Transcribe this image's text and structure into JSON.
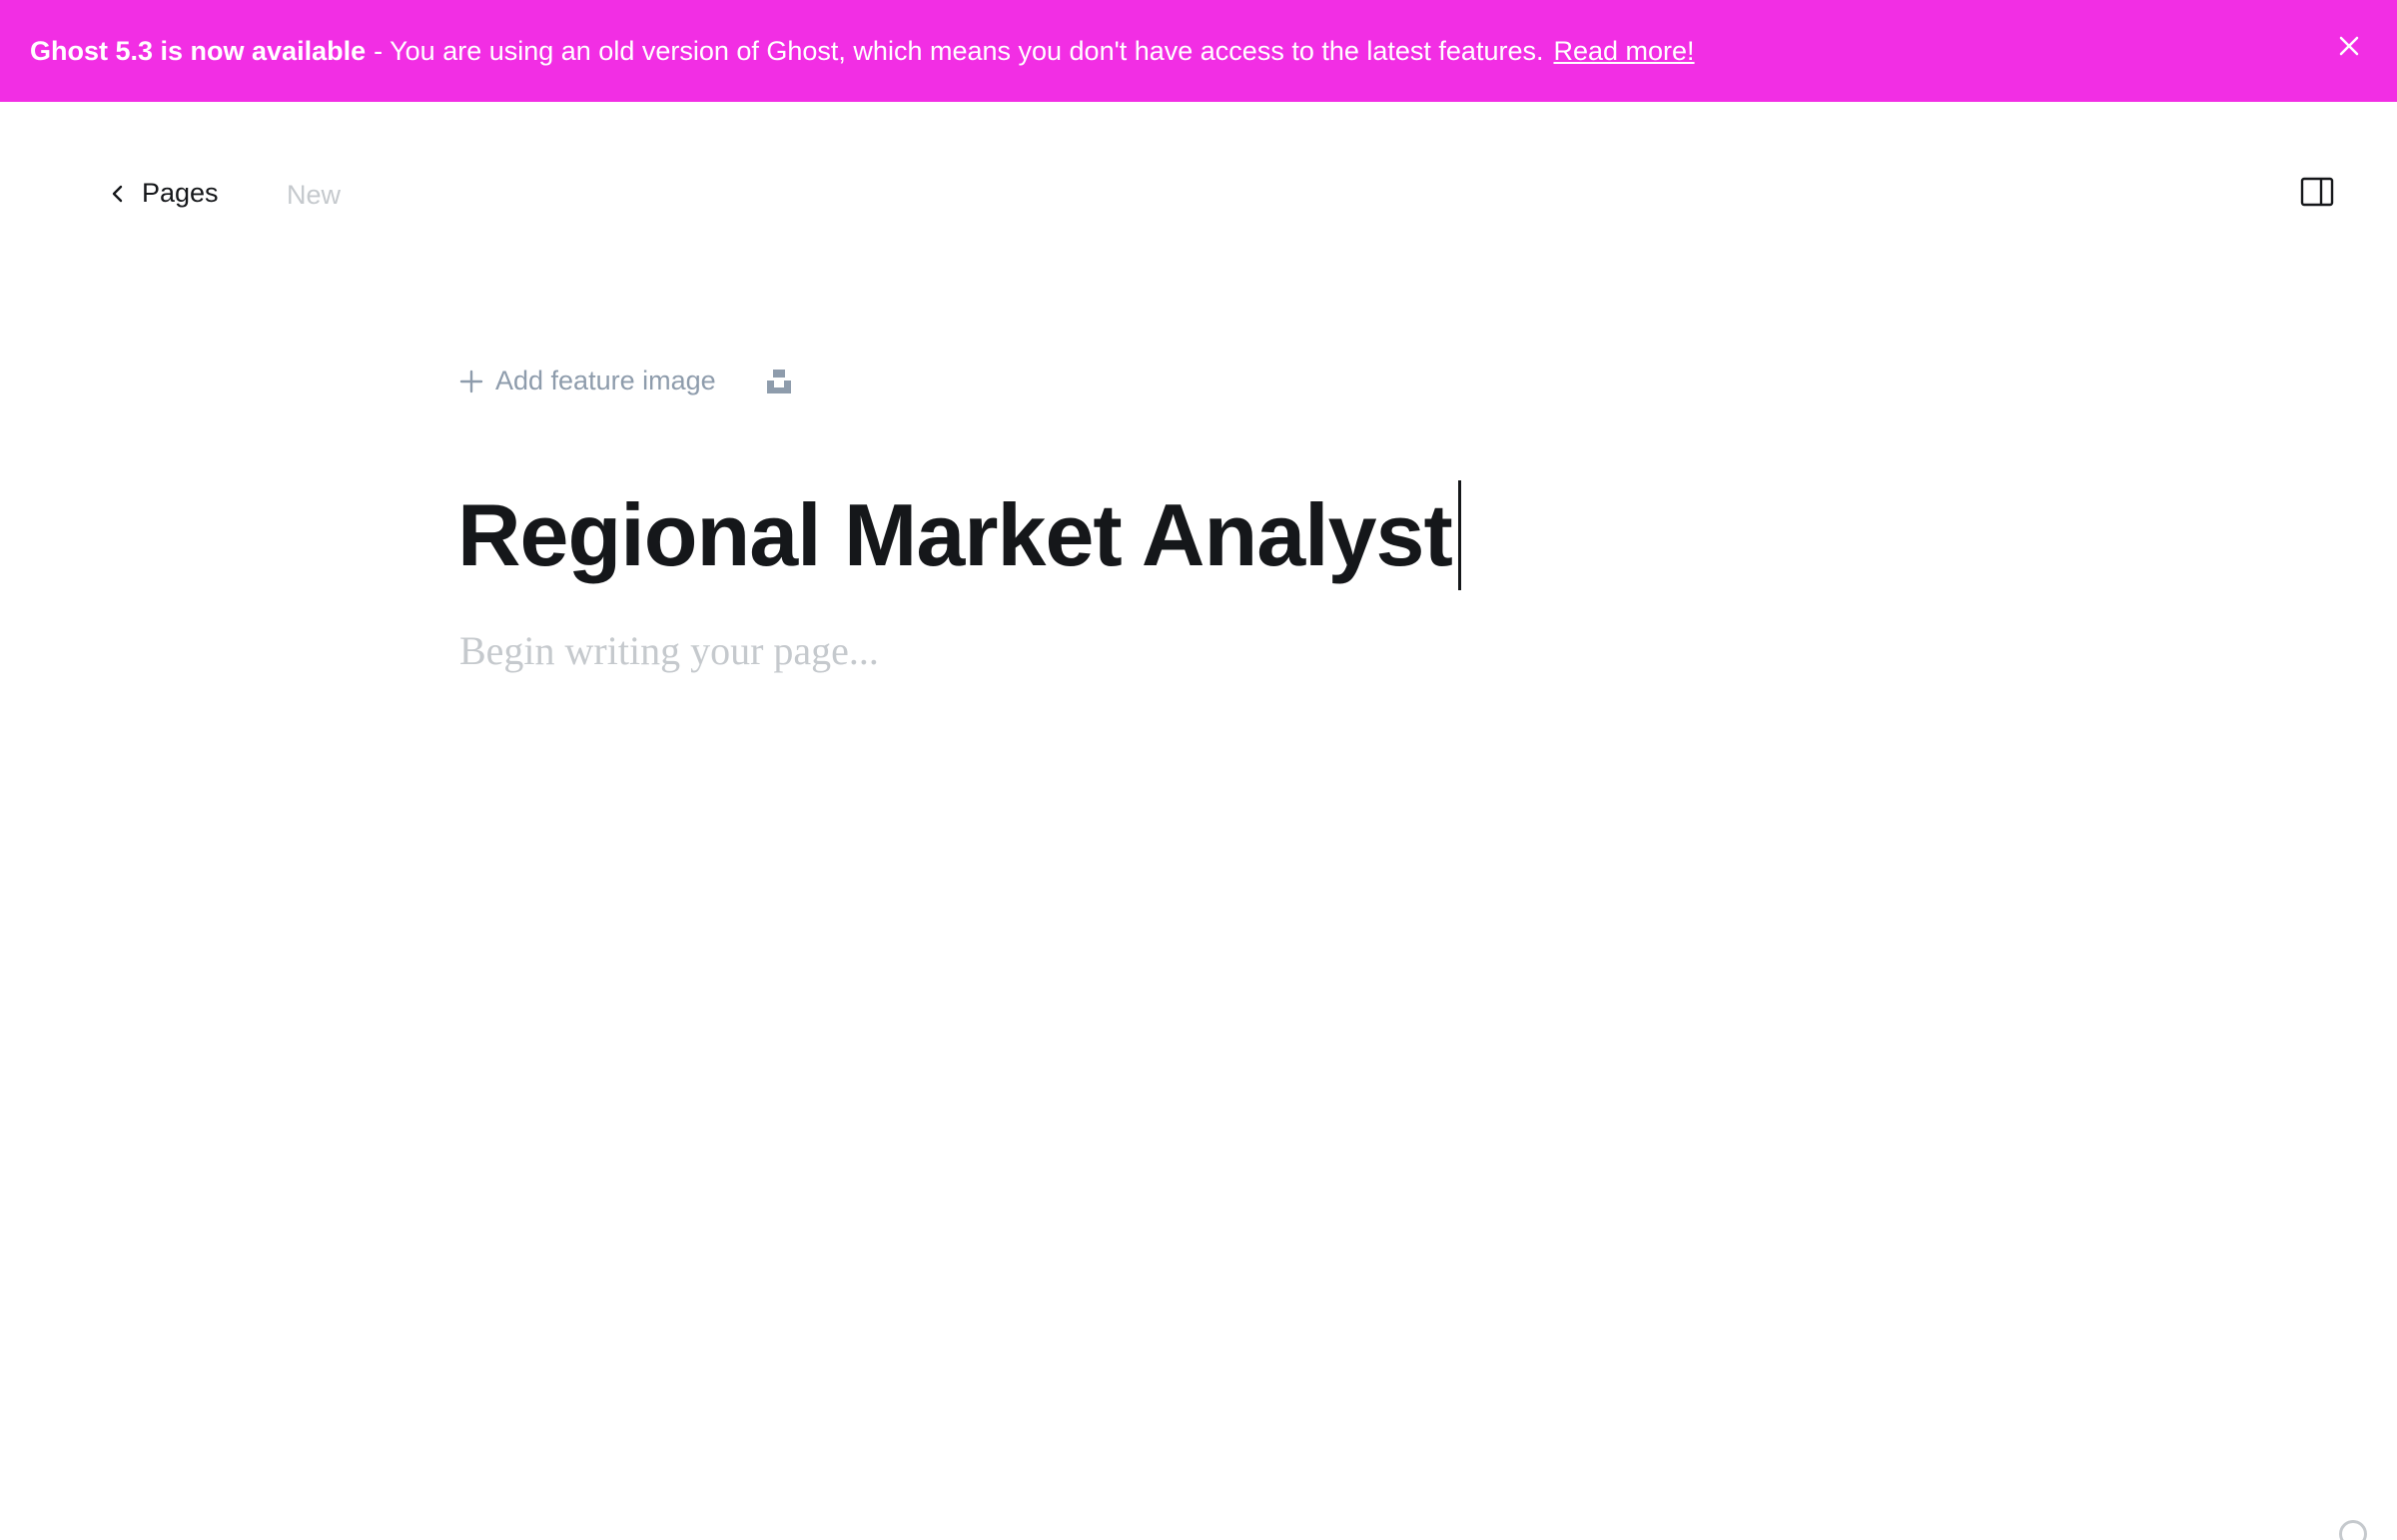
{
  "banner": {
    "version_strong": "Ghost 5.3 is now available",
    "text": "- You are using an old version of Ghost, which means you don't have access to the latest features.",
    "read_more": "Read more!",
    "close_icon": "close-icon",
    "background_color": "#f22ee4"
  },
  "header": {
    "back_label": "Pages",
    "status_label": "New",
    "back_icon": "chevron-left-icon",
    "sidebar_icon": "sidebar-toggle-icon"
  },
  "editor": {
    "add_feature_image_label": "Add feature image",
    "title": "Regional Market Analyst",
    "body_placeholder": "Begin writing your page..."
  },
  "colors": {
    "text": "#15171a",
    "muted": "#8e9cac",
    "placeholder": "#c5c9cd"
  }
}
